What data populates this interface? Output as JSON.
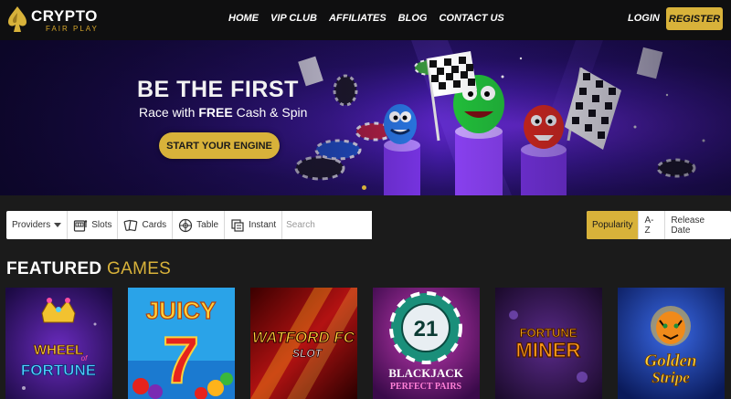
{
  "brand": {
    "name_line1": "CRYPTO",
    "name_line2": "FAIR PLAY"
  },
  "nav": {
    "items": [
      {
        "label": "HOME"
      },
      {
        "label": "VIP CLUB"
      },
      {
        "label": "AFFILIATES"
      },
      {
        "label": "BLOG"
      },
      {
        "label": "CONTACT US"
      }
    ],
    "login_label": "LOGIN",
    "register_label": "REGISTER"
  },
  "hero": {
    "title": "BE THE FIRST",
    "subtitle_pre": "Race with ",
    "subtitle_bold": "FREE",
    "subtitle_post": " Cash & Spin",
    "cta_label": "START YOUR ENGINE",
    "colors": {
      "accent": "#d8b23a"
    }
  },
  "filters": {
    "providers_label": "Providers",
    "items": [
      {
        "label": "Slots",
        "icon": "slot-machine-icon"
      },
      {
        "label": "Cards",
        "icon": "cards-icon"
      },
      {
        "label": "Table",
        "icon": "roulette-icon"
      },
      {
        "label": "Instant",
        "icon": "instant-icon"
      }
    ],
    "search_placeholder": "Search"
  },
  "sort": {
    "items": [
      {
        "label": "Popularity",
        "active": true
      },
      {
        "label": "A-Z",
        "active": false
      },
      {
        "label": "Release Date",
        "active": false
      }
    ]
  },
  "featured": {
    "title_white": "FEATURED",
    "title_gold": "GAMES",
    "games": [
      {
        "line1": "WHEEL",
        "line2": "of",
        "line3": "FORTUNE"
      },
      {
        "line1": "JUICY",
        "line2": "7"
      },
      {
        "line1": "WATFORD FC",
        "line2": "SLOT"
      },
      {
        "line1": "21",
        "line2": "BLACKJACK",
        "line3": "PERFECT PAIRS"
      },
      {
        "line1": "FORTUNE",
        "line2": "MINER"
      },
      {
        "line1": "Golden",
        "line2": "Stripe"
      }
    ]
  }
}
